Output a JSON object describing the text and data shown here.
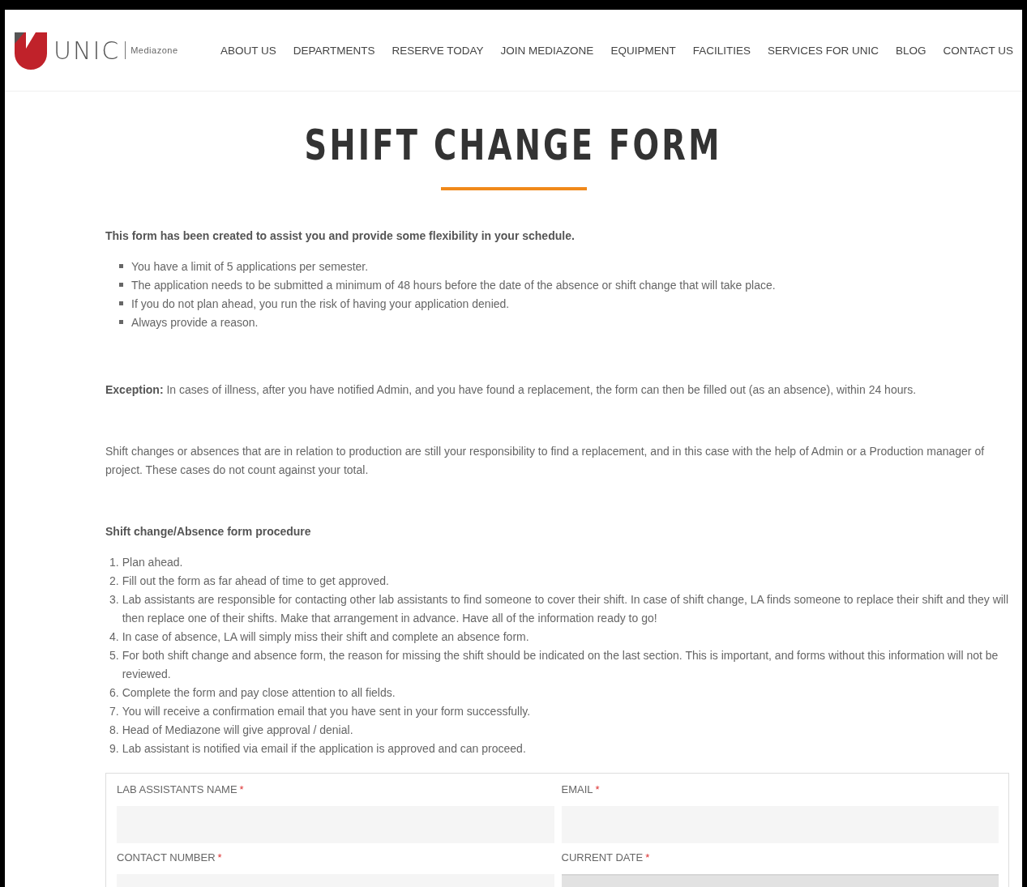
{
  "header": {
    "logo": {
      "wordmark": "UNIC",
      "subtitle": "Mediazone"
    },
    "nav": [
      "ABOUT US",
      "DEPARTMENTS",
      "RESERVE TODAY",
      "JOIN MEDIAZONE",
      "EQUIPMENT",
      "FACILITIES",
      "SERVICES FOR UNIC",
      "BLOG",
      "CONTACT US"
    ]
  },
  "title": "SHIFT CHANGE FORM",
  "intro": "This form has been created to assist you and provide some flexibility in your schedule.",
  "rules": [
    "You have a limit of 5 applications per semester.",
    "The application needs to be submitted a minimum of 48 hours before the date of the absence or shift change that will take place.",
    "If you do not plan ahead, you run the risk of having your application denied.",
    "Always provide a reason."
  ],
  "exception": "**Exception:** In cases of illness, after you have notified Admin, and you have found a replacement, the form can then be filled out (as an absence), within 24 hours.",
  "production_note": "Shift changes or absences that are in relation to production are still your responsibility to find a replacement, and in this case with the help of Admin or a Production manager of project. These cases do not count against your total.",
  "procedure_heading": "Shift change/Absence form procedure",
  "procedure": [
    {
      "number": "1.",
      "text": "Plan ahead."
    },
    {
      "number": "2.",
      "text": "Fill out the form as far ahead of time to get approved."
    },
    {
      "number": "3.",
      "text": "Lab assistants are responsible for contacting other lab assistants to find someone to cover their shift. In case of shift change, LA finds someone to replace their shift and they will then replace one of their shifts. Make that arrangement in advance. Have all of the information ready to go!"
    },
    {
      "number": "4.",
      "text": "In case of absence, LA will simply miss their shift and complete an absence form."
    },
    {
      "number": "5.",
      "text": "For both shift change and absence form, the reason for missing the shift should be indicated on the last section. This is important, and forms without this information will not be reviewed."
    },
    {
      "number": "6.",
      "text": "Complete the form and pay close attention to all fields."
    },
    {
      "number": "7.",
      "text": "You will receive a confirmation email that you have sent in your form successfully."
    },
    {
      "number": "8.",
      "text": "Head of Mediazone will give approval / denial."
    },
    {
      "number": "9.",
      "text": "Lab assistant is notified via email if the application is approved and can proceed."
    }
  ],
  "form": {
    "fields": [
      {
        "label": "LAB ASSISTANTS NAME",
        "required_mark": "*",
        "readonly": false
      },
      {
        "label": "EMAIL",
        "required_mark": "*",
        "readonly": false
      },
      {
        "label": "CONTACT NUMBER",
        "required_mark": "*",
        "readonly": false
      },
      {
        "label": "CURRENT DATE",
        "required_mark": "*",
        "readonly": true
      }
    ]
  }
}
